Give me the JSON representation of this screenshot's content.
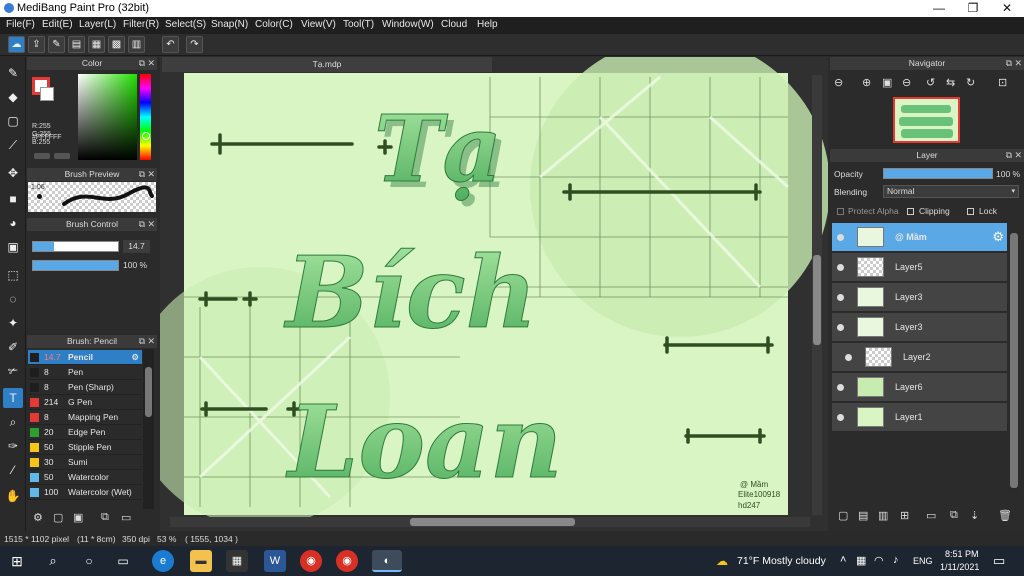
{
  "window": {
    "title": "MediBang Paint Pro (32bit)",
    "minimize": "—",
    "maximize": "❐",
    "close": "✕"
  },
  "menu": [
    "File(F)",
    "Edit(E)",
    "Layer(L)",
    "Filter(R)",
    "Select(S)",
    "Snap(N)",
    "Color(C)",
    "View(V)",
    "Tool(T)",
    "Window(W)",
    "Cloud",
    "Help"
  ],
  "color_panel": {
    "title": "Color",
    "r": "R:255",
    "g": "G:255",
    "b": "B:255",
    "hex": "#FFFFFF"
  },
  "brush_preview": {
    "title": "Brush Preview",
    "size": "1.06"
  },
  "brush_control": {
    "title": "Brush Control",
    "size": "14.7",
    "size_fraction": 0.25,
    "opacity": "100 %",
    "opacity_fraction": 1.0
  },
  "brush_list": {
    "title": "Brush: Pencil",
    "items": [
      {
        "size": "14.7",
        "name": "Pencil",
        "color": "#1e1e1e",
        "selected": true
      },
      {
        "size": "8",
        "name": "Pen",
        "color": "#1e1e1e"
      },
      {
        "size": "8",
        "name": "Pen (Sharp)",
        "color": "#1e1e1e"
      },
      {
        "size": "214",
        "name": "G Pen",
        "color": "#e53935"
      },
      {
        "size": "8",
        "name": "Mapping Pen",
        "color": "#e53935"
      },
      {
        "size": "20",
        "name": "Edge Pen",
        "color": "#2e9e2e"
      },
      {
        "size": "50",
        "name": "Stipple Pen",
        "color": "#f5c518"
      },
      {
        "size": "30",
        "name": "Sumi",
        "color": "#f5c518"
      },
      {
        "size": "50",
        "name": "Watercolor",
        "color": "#5fb8e8"
      },
      {
        "size": "100",
        "name": "Watercolor (Wet)",
        "color": "#5fb8e8"
      }
    ]
  },
  "document": {
    "tab": "Tạ.mdp",
    "artwork_words": [
      "Tạ",
      "Bích",
      "Loan"
    ],
    "signature": [
      "@ Mầm",
      "Elite100918",
      "hd247"
    ]
  },
  "navigator": {
    "title": "Navigator"
  },
  "layer_panel": {
    "title": "Layer",
    "opacity_label": "Opacity",
    "opacity_value": "100 %",
    "opacity_fraction": 1.0,
    "blending_label": "Blending",
    "blending_value": "Normal",
    "protect_alpha": "Protect Alpha",
    "clipping": "Clipping",
    "lock": "Lock",
    "layers": [
      {
        "name": "@ Mầm",
        "selected": true
      },
      {
        "name": "Layer5"
      },
      {
        "name": "Layer3"
      },
      {
        "name": "Layer3"
      },
      {
        "name": "Layer2",
        "indent": true
      },
      {
        "name": "Layer6"
      },
      {
        "name": "Layer1"
      }
    ]
  },
  "status": {
    "size": "1515 * 1102 pixel",
    "cm": "(11 * 8cm)",
    "dpi": "350 dpi",
    "zoom": "53 %",
    "coords": "( 1555, 1034 )"
  },
  "taskbar": {
    "weather": "71°F  Mostly cloudy",
    "lang": "ENG",
    "time": "8:51 PM",
    "date": "1/11/2021"
  },
  "colors": {
    "accent": "#2f7fc6",
    "canvas_bg": "#d9f5c4",
    "letter_green": "#6ac27a",
    "line_dark": "#2f4f22"
  }
}
